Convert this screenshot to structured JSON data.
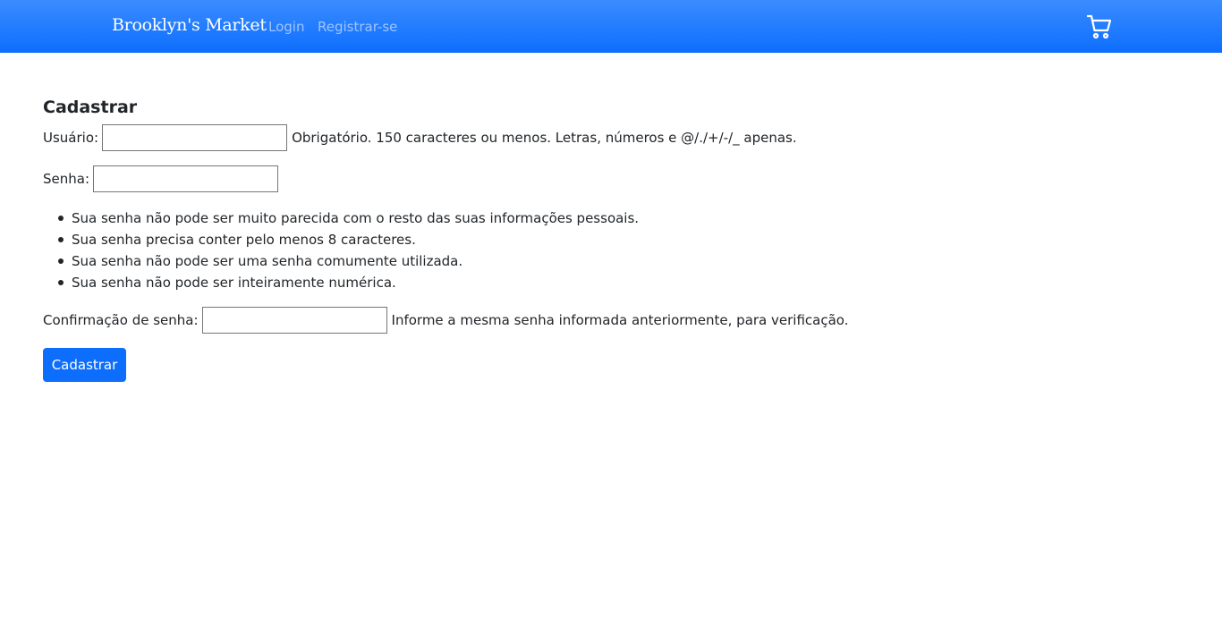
{
  "navbar": {
    "brand": "Brooklyn's Market",
    "links": [
      {
        "label": "Login"
      },
      {
        "label": "Registrar-se"
      }
    ],
    "cart_icon": "cart-icon",
    "colors": {
      "background": "#0d6efd",
      "link": "#ffffff"
    }
  },
  "form": {
    "title": "Cadastrar",
    "username": {
      "label": "Usuário:",
      "value": "",
      "help": "Obrigatório. 150 caracteres ou menos. Letras, números e @/./+/-/_ apenas."
    },
    "password": {
      "label": "Senha:",
      "value": ""
    },
    "password_rules": [
      "Sua senha não pode ser muito parecida com o resto das suas informações pessoais.",
      "Sua senha precisa conter pelo menos 8 caracteres.",
      "Sua senha não pode ser uma senha comumente utilizada.",
      "Sua senha não pode ser inteiramente numérica."
    ],
    "password_confirm": {
      "label": "Confirmação de senha:",
      "value": "",
      "help": "Informe a mesma senha informada anteriormente, para verificação."
    },
    "submit_label": "Cadastrar",
    "colors": {
      "button": "#0d6efd"
    }
  }
}
